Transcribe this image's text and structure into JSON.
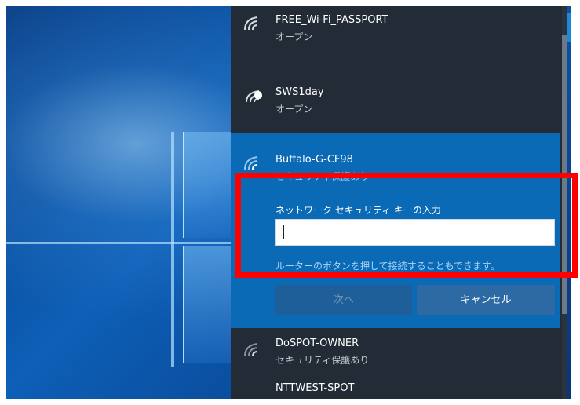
{
  "networks": [
    {
      "name": "FREE_Wi-Fi_PASSPORT",
      "status": "オープン",
      "icon": "wifi-icon"
    },
    {
      "name": "SWS1day",
      "status": "オープン",
      "icon": "wifi-shield-icon"
    },
    {
      "name": "Buffalo-G-CF98",
      "status": "セキュリティ保護あり",
      "icon": "wifi-icon"
    },
    {
      "name": "DoSPOT-OWNER",
      "status": "セキュリティ保護あり",
      "icon": "wifi-icon"
    },
    {
      "name": "NTTWEST-SPOT",
      "status": "",
      "icon": "wifi-icon"
    }
  ],
  "connect_form": {
    "prompt": "ネットワーク セキュリティ キーの入力",
    "key_value": "",
    "router_hint": "ルーターのボタンを押して接続することもできます。",
    "next_label": "次へ",
    "cancel_label": "キャンセル"
  },
  "colors": {
    "highlight": "#ff0000",
    "selected_bg": "#0b6ab6",
    "flyout_bg": "#222b36"
  }
}
